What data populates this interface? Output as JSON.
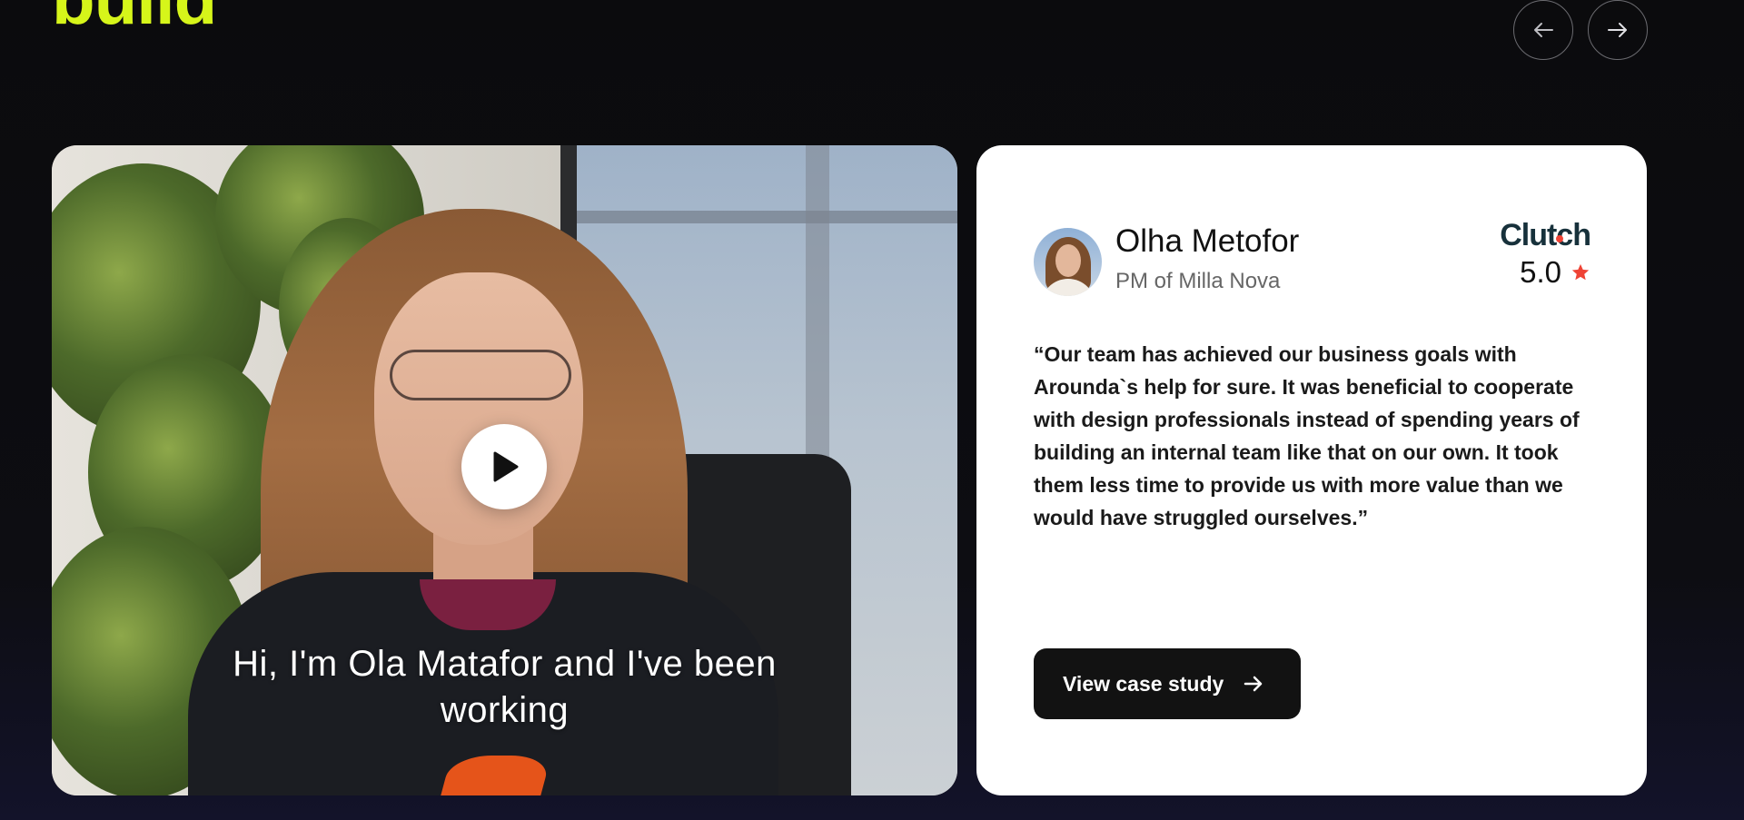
{
  "section": {
    "heading": "build"
  },
  "navigation": {
    "prev_icon": "arrow-left-icon",
    "next_icon": "arrow-right-icon"
  },
  "video": {
    "caption": "Hi, I'm Ola Matafor and I've been working",
    "play_icon": "play-icon"
  },
  "testimonial": {
    "name": "Olha Metofor",
    "role": "PM of Milla Nova",
    "platform": "Clutch",
    "rating": "5.0",
    "quote": "“Our team has achieved our business goals with Arounda`s help for sure. It was beneficial to cooperate with design professionals instead of spending years of building an internal team like that on our own. It took them less time to provide us with more value than we would have struggled ourselves.”",
    "cta_label": "View case study"
  },
  "colors": {
    "accent": "#d6f51a",
    "star": "#ef4335",
    "card_bg": "#ffffff",
    "page_bg": "#0c0c0f"
  }
}
